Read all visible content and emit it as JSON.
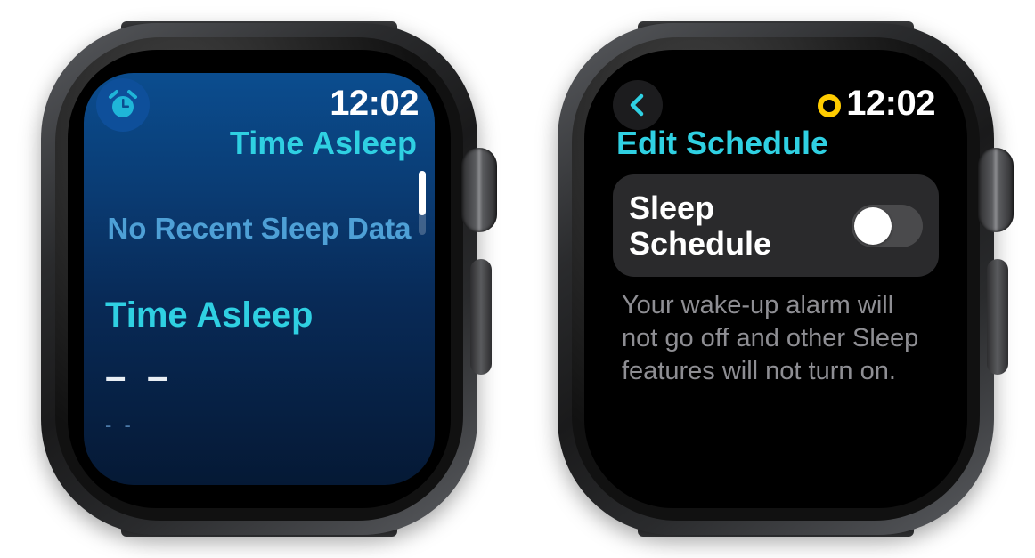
{
  "watch1": {
    "time": "12:02",
    "app_title": "Time Asleep",
    "no_data": "No Recent Sleep Data",
    "section": "Time Asleep",
    "value_major": "– –",
    "value_minor": "- -",
    "icon": "alarm-clock-icon",
    "accent_color": "#2fd0e2"
  },
  "watch2": {
    "time": "12:02",
    "title": "Edit Schedule",
    "toggle": {
      "label": "Sleep Schedule",
      "on": false
    },
    "caption": "Your wake-up alarm will not go off and other Sleep features will not turn on.",
    "indicator": "activity-ring",
    "accent_color": "#2fd0e2"
  }
}
